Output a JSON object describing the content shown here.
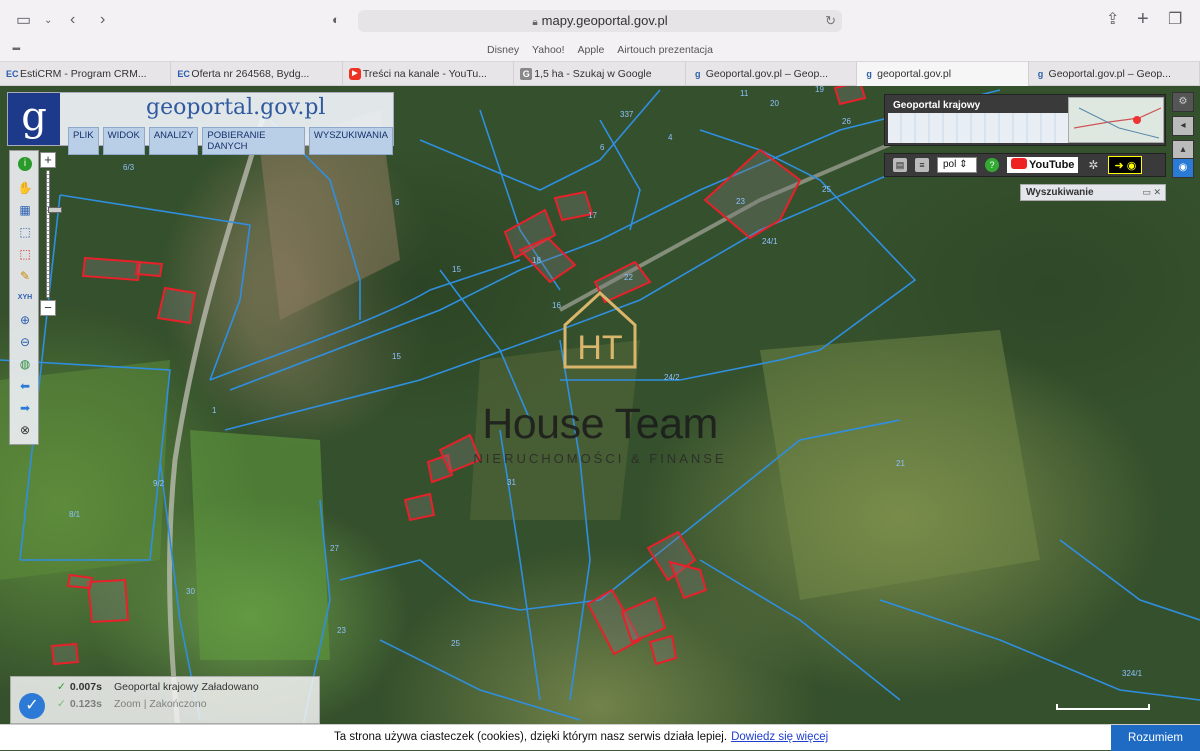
{
  "browser": {
    "url": "mapy.geoportal.gov.pl",
    "favorites": [
      "Disney",
      "Yahoo!",
      "Apple",
      "Airtouch prezentacja"
    ],
    "tabs": [
      {
        "label": "EstiCRM - Program CRM...",
        "icon": "ec-icon"
      },
      {
        "label": "Oferta nr 264568, Bydg...",
        "icon": "ec-icon"
      },
      {
        "label": "Treści na kanale - YouTu...",
        "icon": "youtube-icon"
      },
      {
        "label": "1,5 ha - Szukaj w Google",
        "icon": "google-icon"
      },
      {
        "label": "Geoportal.gov.pl – Geop...",
        "icon": "geoportal-icon"
      },
      {
        "label": "geoportal.gov.pl",
        "icon": "geoportal-icon",
        "active": true
      },
      {
        "label": "Geoportal.gov.pl – Geop...",
        "icon": "geoportal-icon"
      }
    ]
  },
  "geoportal": {
    "logo_text": "geoportal.gov.pl",
    "menu": [
      "PLIK",
      "WIDOK",
      "ANALIZY",
      "POBIERANIE DANYCH",
      "WYSZUKIWANIA"
    ],
    "overview_title": "Geoportal krajowy",
    "language": "pol",
    "youtube_label": "YouTube",
    "search_panel_title": "Wyszukiwanie",
    "xyh_label": "XYH"
  },
  "watermark": {
    "brand": "House Team",
    "subtitle": "NIERUCHOMOŚCI & FINANSE",
    "mark": "HT"
  },
  "parcels": [
    "337",
    "6",
    "4",
    "20",
    "20",
    "19",
    "26",
    "11",
    "5",
    "6/3",
    "6",
    "15",
    "17",
    "18",
    "22",
    "25",
    "24/1",
    "23",
    "16",
    "15",
    "1",
    "24/2",
    "9/2",
    "8/1",
    "27",
    "31",
    "21",
    "30",
    "23",
    "25",
    "9/1",
    "20",
    "1",
    "1",
    "324/1"
  ],
  "status_log": [
    {
      "time": "0.007s",
      "source": "Geoportal krajowy",
      "status": "Załadowano"
    },
    {
      "time": "0.123s",
      "source": "Zoom",
      "status": "Zakończono"
    }
  ],
  "cookie": {
    "text": "Ta strona używa ciasteczek (cookies), dzięki którym nasz serwis działa lepiej.",
    "link": "Dowiedz się więcej",
    "button": "Rozumiem"
  },
  "colors": {
    "parcel_boundary": "#2f8fe0",
    "building_outline": "#e8202a",
    "geoportal_blue": "#1d3a8a",
    "cookie_button": "#1f6bc4"
  }
}
